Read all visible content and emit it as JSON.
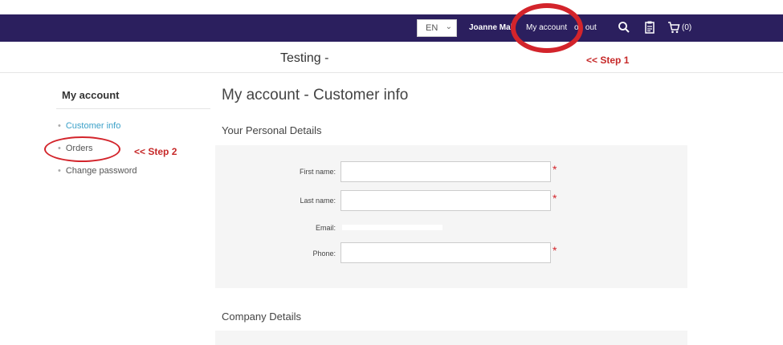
{
  "header": {
    "language": "EN",
    "user_name": "Joanne Mal",
    "my_account": "My account",
    "logout": "og out",
    "cart_count": "(0)"
  },
  "store_title": "Testing -",
  "annotations": {
    "step1": "<< Step 1",
    "step2": "<< Step 2"
  },
  "sidebar": {
    "title": "My account",
    "items": [
      {
        "label": "Customer info",
        "active": true
      },
      {
        "label": "Orders",
        "active": false
      },
      {
        "label": "Change password",
        "active": false
      }
    ]
  },
  "main": {
    "title": "My account - Customer info",
    "sections": {
      "personal": "Your Personal Details",
      "company": "Company Details"
    },
    "fields": {
      "first_name": {
        "label": "First name:",
        "value": ""
      },
      "last_name": {
        "label": "Last name:",
        "value": ""
      },
      "email": {
        "label": "Email:",
        "value": ""
      },
      "phone": {
        "label": "Phone:",
        "value": ""
      }
    },
    "required_mark": "*"
  },
  "colors": {
    "navbar": "#2b1f5e",
    "accent_link": "#3aa0c8",
    "annotation": "#d3242b"
  }
}
